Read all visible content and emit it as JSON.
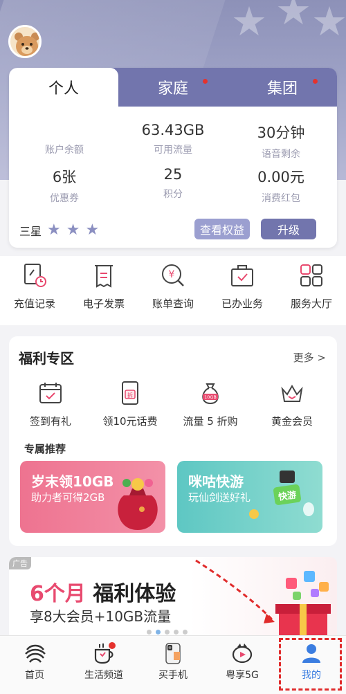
{
  "account_card": {
    "tabs": [
      {
        "label": "个人",
        "active": true,
        "has_dot": false
      },
      {
        "label": "家庭",
        "active": false,
        "has_dot": true
      },
      {
        "label": "集团",
        "active": false,
        "has_dot": true
      }
    ],
    "stats": [
      {
        "value": "",
        "label": "账户余额"
      },
      {
        "value": "63.43GB",
        "label": "可用流量"
      },
      {
        "value": "30分钟",
        "label": "语音剩余"
      },
      {
        "value": "6张",
        "label": "优惠券"
      },
      {
        "value": "25",
        "label": "积分"
      },
      {
        "value": "0.00元",
        "label": "消费红包"
      }
    ],
    "level": {
      "label": "三星",
      "stars": 3
    },
    "view_benefits_label": "查看权益",
    "upgrade_label": "升级"
  },
  "quick_actions": [
    {
      "label": "充值记录",
      "icon": "recharge-record-icon"
    },
    {
      "label": "电子发票",
      "icon": "invoice-icon"
    },
    {
      "label": "账单查询",
      "icon": "bill-query-icon"
    },
    {
      "label": "已办业务",
      "icon": "handled-business-icon"
    },
    {
      "label": "服务大厅",
      "icon": "service-hall-icon"
    }
  ],
  "welfare": {
    "title": "福利专区",
    "more_label": "更多 >",
    "items": [
      {
        "label": "签到有礼",
        "icon": "calendar-check-icon"
      },
      {
        "label": "领10元话费",
        "icon": "red-envelope-icon",
        "icon_text": "拆"
      },
      {
        "label": "流量 5 折购",
        "icon": "money-bag-icon",
        "icon_text": "10GB"
      },
      {
        "label": "黄金会员",
        "icon": "crown-icon"
      }
    ],
    "recommend_title": "专属推荐",
    "banners": [
      {
        "title": "岁末领10GB",
        "subtitle": "助力者可得2GB"
      },
      {
        "title": "咪咕快游",
        "subtitle": "玩仙剑送好礼",
        "badge": "快游"
      }
    ]
  },
  "ad": {
    "tag": "广告",
    "title_highlight": "6个月",
    "title_rest": " 福利体验",
    "subtitle": "享8大会员+10GB流量"
  },
  "tab_bar": [
    {
      "label": "首页",
      "icon": "china-mobile-logo-icon",
      "active": false
    },
    {
      "label": "生活频道",
      "icon": "coffee-cup-icon",
      "active": false,
      "has_dot": true
    },
    {
      "label": "买手机",
      "icon": "phone-icon",
      "active": false
    },
    {
      "label": "粤享5G",
      "icon": "5g-logo-icon",
      "active": false
    },
    {
      "label": "我的",
      "icon": "person-icon",
      "active": true
    }
  ],
  "colors": {
    "header_purple": "#7275ad",
    "accent_pink": "#e84a6f",
    "active_blue": "#3b7de0"
  }
}
